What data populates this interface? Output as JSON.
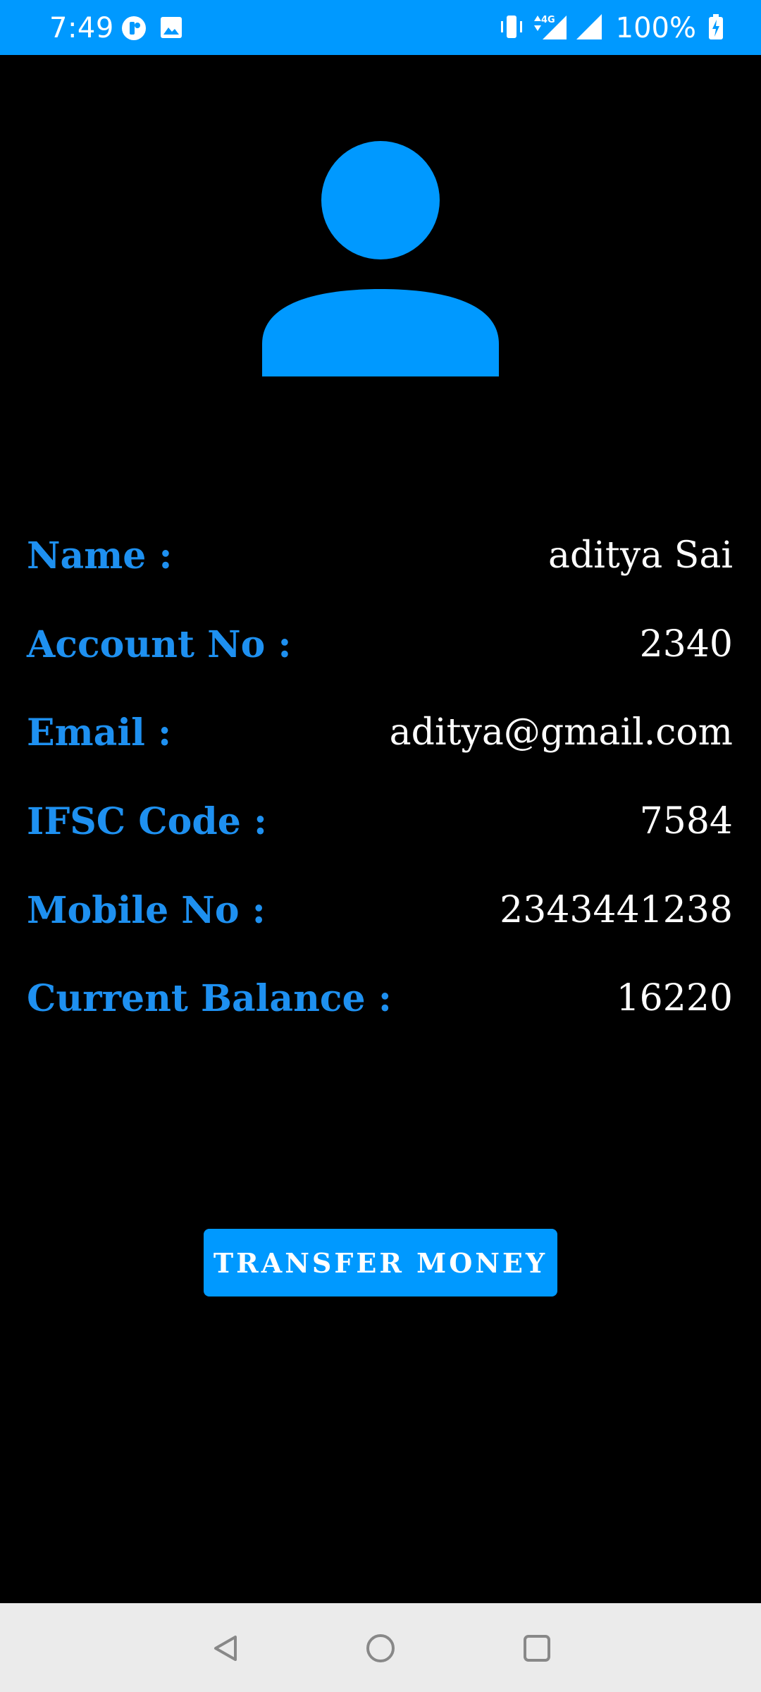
{
  "status_bar": {
    "time": "7:49",
    "battery_percent": "100%",
    "network_label": "4G",
    "icons": [
      "app-notification-icon",
      "image-icon",
      "vibrate-icon",
      "data-signal-icon",
      "signal-icon",
      "battery-charging-icon"
    ],
    "background_color": "#0099FF"
  },
  "profile": {
    "avatar_icon": "person-icon",
    "accent_color": "#0099FF",
    "fields": [
      {
        "label": "Name :",
        "value": "aditya Sai"
      },
      {
        "label": "Account No :",
        "value": "2340"
      },
      {
        "label": "Email :",
        "value": "aditya@gmail.com"
      },
      {
        "label": "IFSC Code :",
        "value": "7584"
      },
      {
        "label": "Mobile No :",
        "value": "2343441238"
      },
      {
        "label": "Current Balance :",
        "value": "16220"
      }
    ]
  },
  "actions": {
    "transfer_label": "TRANSFER MONEY"
  },
  "nav_bar": {
    "buttons": [
      "back-icon",
      "home-icon",
      "recents-icon"
    ]
  }
}
